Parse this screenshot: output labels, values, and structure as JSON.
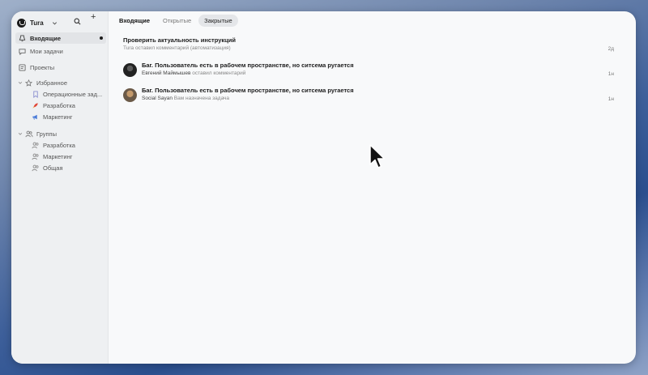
{
  "workspace": {
    "name": "Tura",
    "add_label": "+"
  },
  "sidebar": {
    "inbox": "Входящие",
    "my_tasks": "Мои задачи",
    "projects": "Проекты",
    "favorites": {
      "label": "Избранное",
      "items": [
        "Операционные зад...",
        "Разработка",
        "Маркетинг"
      ]
    },
    "groups": {
      "label": "Группы",
      "items": [
        "Разработка",
        "Маркетинг",
        "Общая"
      ]
    }
  },
  "tabs": {
    "title": "Входящие",
    "open": "Открытые",
    "closed": "Закрытые"
  },
  "notifications": [
    {
      "title": "Проверить актуальность инструкций",
      "actor": "Tura",
      "action": "оставил комментарий (автоматизация)",
      "time": "2д"
    },
    {
      "title": "Баг. Пользователь есть в рабочем пространстве, но ситсема ругается",
      "actor": "Евгений Маймышев",
      "action": "оставил комментарий",
      "time": "1н"
    },
    {
      "title": "Баг. Пользователь есть в рабочем пространстве, но ситсема ругается",
      "actor": "Social Sayan",
      "action": "Вам назначена задача",
      "time": "1н"
    }
  ],
  "colors": {
    "accent_dot": "#1c1c1c",
    "rocket": "#e0483a",
    "megaphone": "#4a7bd8"
  },
  "icons": [
    "inbox-icon",
    "chat-icon",
    "projects-icon",
    "star-icon",
    "bookmark-icon",
    "rocket-icon",
    "megaphone-icon",
    "users-icon",
    "user-icon",
    "search-icon",
    "chevron-down-icon"
  ]
}
